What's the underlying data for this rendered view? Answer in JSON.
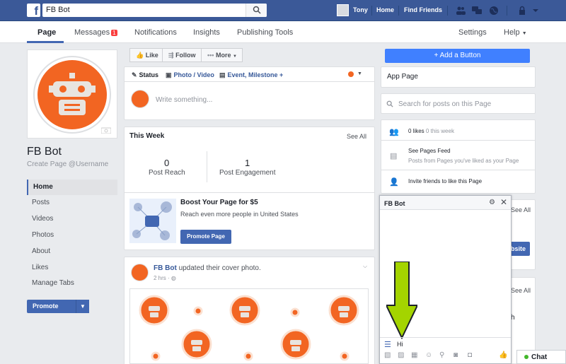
{
  "topbar": {
    "logo": "f",
    "search_value": "FB Bot",
    "user_name": "Tony",
    "home": "Home",
    "find_friends": "Find Friends"
  },
  "nav": {
    "page": "Page",
    "messages": "Messages",
    "messages_badge": "1",
    "notifications": "Notifications",
    "insights": "Insights",
    "publishing_tools": "Publishing Tools",
    "settings": "Settings",
    "help": "Help"
  },
  "profile": {
    "name": "FB Bot",
    "username": "Create Page @Username"
  },
  "sidebar": {
    "items": [
      "Home",
      "Posts",
      "Videos",
      "Photos",
      "About",
      "Likes",
      "Manage Tabs"
    ],
    "promote": "Promote"
  },
  "actions": {
    "like": "Like",
    "follow": "Follow",
    "more": "More",
    "add_button": "+ Add a Button"
  },
  "composer": {
    "status": "Status",
    "photo_video": "Photo / Video",
    "event": "Event, Milestone +",
    "placeholder": "Write something..."
  },
  "this_week": {
    "title": "This Week",
    "see_all": "See All",
    "post_reach_value": "0",
    "post_reach_label": "Post Reach",
    "engagement_value": "1",
    "engagement_label": "Post Engagement"
  },
  "boost": {
    "title": "Boost Your Page for $5",
    "subtitle": "Reach even more people in United States",
    "button": "Promote Page"
  },
  "post": {
    "author": "FB Bot",
    "action": "updated their cover photo.",
    "time": "2 hrs"
  },
  "right": {
    "app_page": "App Page",
    "search_placeholder": "Search for posts on this Page",
    "likes_count": "0 likes",
    "likes_week": "0 this week",
    "see_pages_feed": "See Pages Feed",
    "pages_feed_sub": "Posts from Pages you've liked as your Page",
    "invite": "Invite friends to like this Page",
    "see_all_1": "See All",
    "site_btn": "bsite",
    "see_all_2": "See All",
    "partial_h": "h"
  },
  "chat": {
    "title": "FB Bot",
    "input": "Hi",
    "tab": "Chat"
  },
  "colors": {
    "brand": "#3b5998",
    "accent": "#4267b2",
    "robot_orange": "#f26522",
    "arrow_green": "#a4d400"
  }
}
